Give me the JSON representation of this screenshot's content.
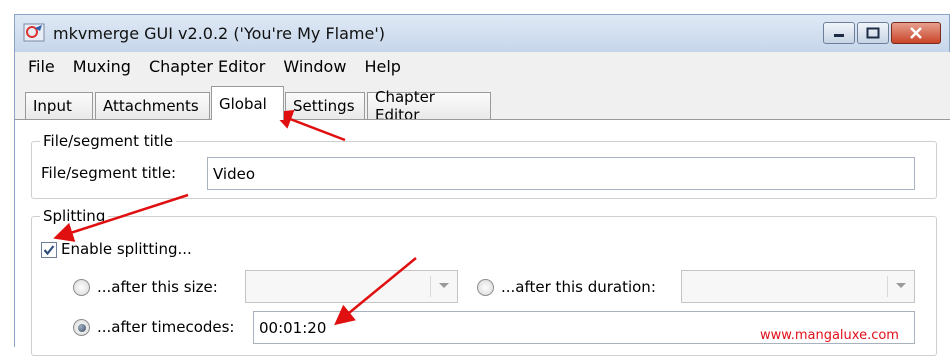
{
  "window": {
    "title": "mkvmerge GUI v2.0.2 ('You're My Flame')",
    "controls": [
      "minimize",
      "maximize",
      "close"
    ]
  },
  "menu": [
    "File",
    "Muxing",
    "Chapter Editor",
    "Window",
    "Help"
  ],
  "tabs": [
    {
      "label": "Input",
      "active": false
    },
    {
      "label": "Attachments",
      "active": false
    },
    {
      "label": "Global",
      "active": true
    },
    {
      "label": "Settings",
      "active": false
    },
    {
      "label": "Chapter Editor",
      "active": false
    }
  ],
  "file_segment": {
    "group_title": "File/segment title",
    "field_label": "File/segment title:",
    "field_value": "Video"
  },
  "splitting": {
    "group_title": "Splitting",
    "enable_label": "Enable splitting...",
    "enable_checked": true,
    "after_size_label": "...after this size:",
    "after_duration_label": "...after this duration:",
    "after_timecodes_label": "...after timecodes:",
    "timecodes_value": "00:01:20",
    "selected_option": "after_timecodes"
  },
  "watermark": "www.mangaluxe.com",
  "colors": {
    "annotation_arrow": "#e01010",
    "watermark": "#e0101a"
  }
}
